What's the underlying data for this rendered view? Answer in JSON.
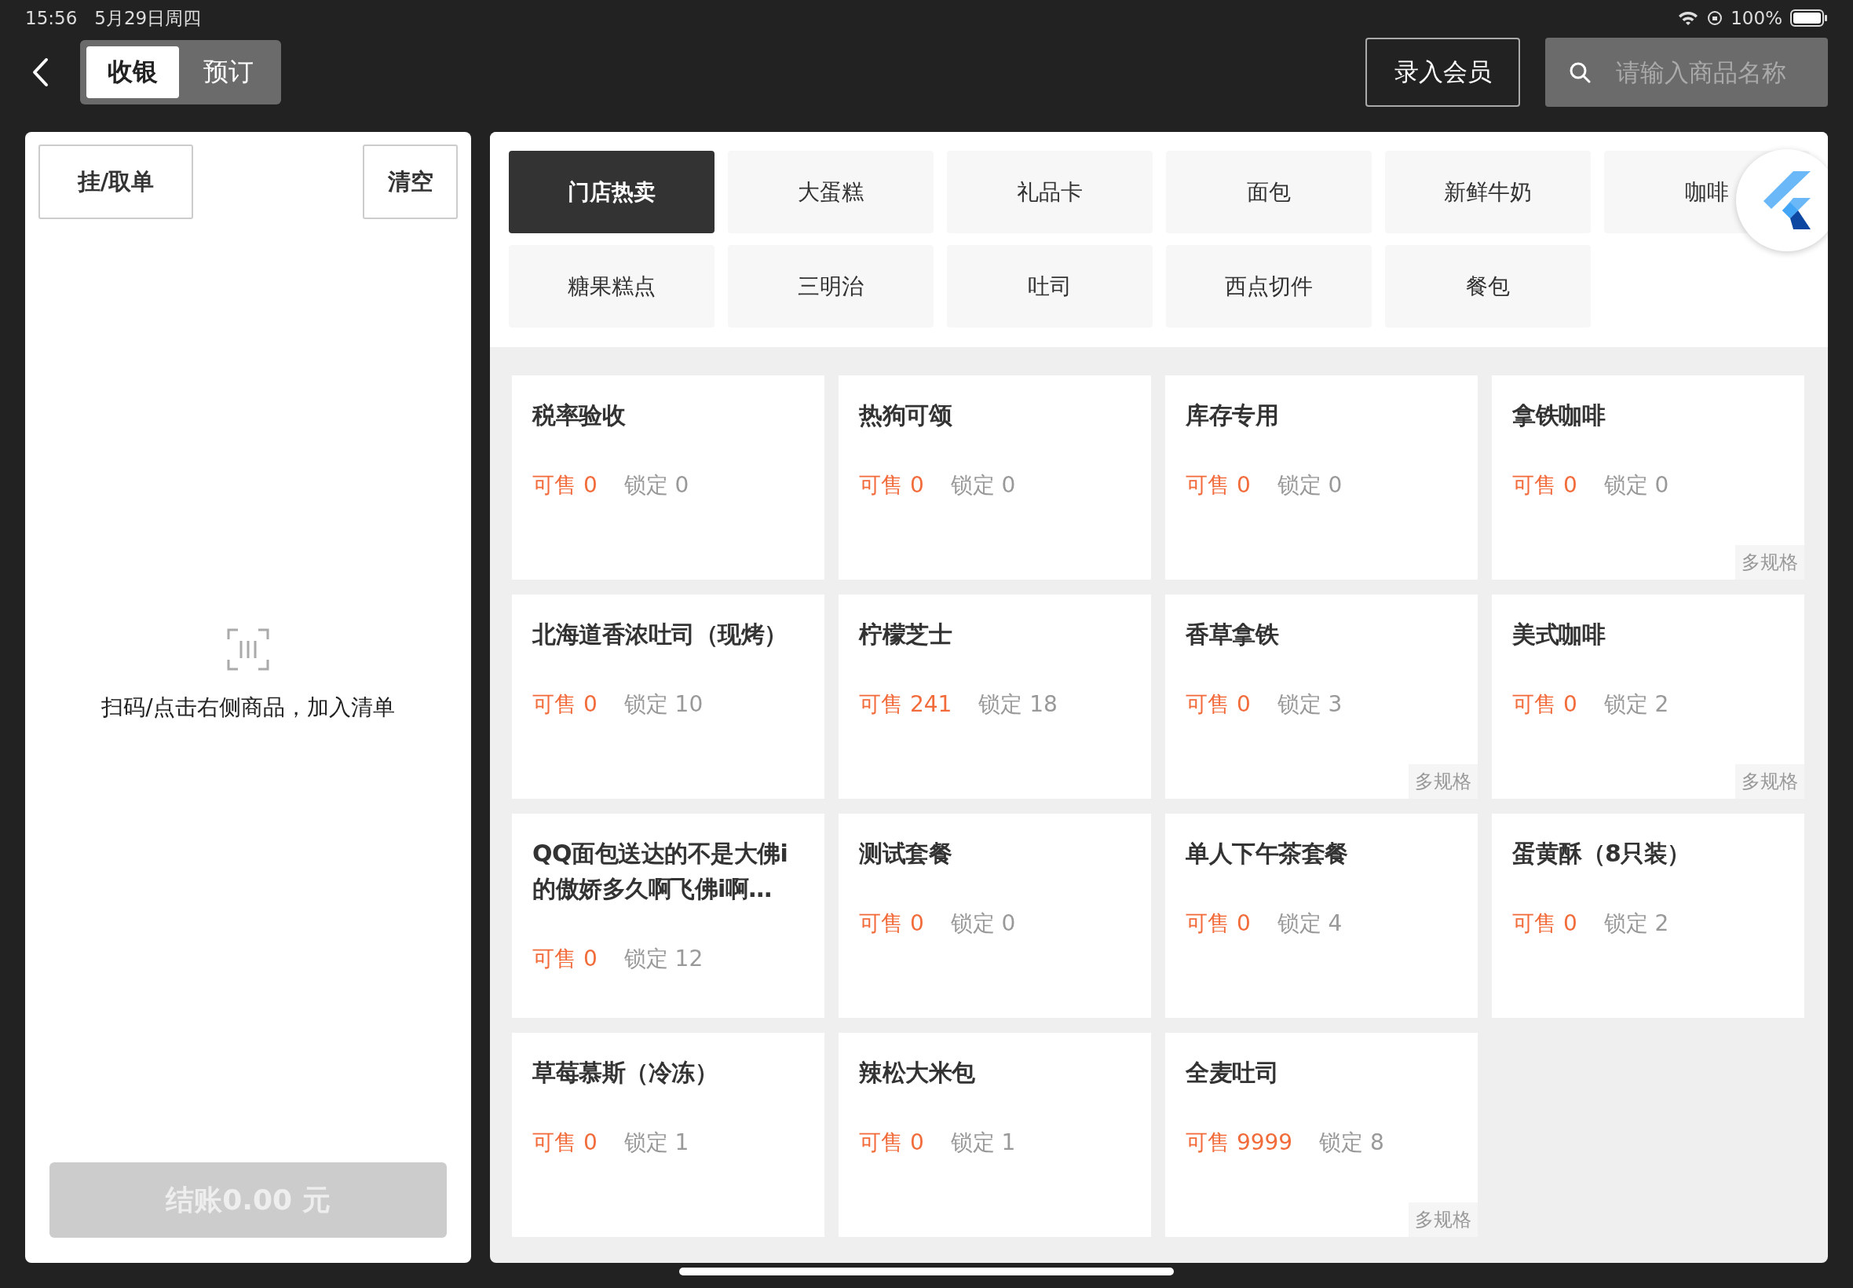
{
  "status_bar": {
    "time": "15:56",
    "date": "5月29日周四",
    "battery": "100%"
  },
  "header": {
    "modes": [
      {
        "label": "收银",
        "selected": true
      },
      {
        "label": "预订",
        "selected": false
      }
    ],
    "member_button": "录入会员",
    "search": {
      "placeholder": "请输入商品名称"
    }
  },
  "cart": {
    "buttons": [
      "挂/取单",
      "清空"
    ],
    "empty_hint": "扫码/点击右侧商品，加入清单",
    "checkout": {
      "label": "结账0.00 元",
      "disabled": true
    }
  },
  "categories": [
    {
      "label": "门店热卖",
      "selected": true
    },
    {
      "label": "大蛋糕",
      "selected": false
    },
    {
      "label": "礼品卡",
      "selected": false
    },
    {
      "label": "面包",
      "selected": false
    },
    {
      "label": "新鲜牛奶",
      "selected": false
    },
    {
      "label": "咖啡",
      "selected": false
    },
    {
      "label": "糖果糕点",
      "selected": false
    },
    {
      "label": "三明治",
      "selected": false
    },
    {
      "label": "吐司",
      "selected": false
    },
    {
      "label": "西点切件",
      "selected": false
    },
    {
      "label": "餐包",
      "selected": false
    }
  ],
  "products": [
    {
      "name": "税率验收",
      "available": "可售 0",
      "locked": "锁定 0"
    },
    {
      "name": "热狗可颂",
      "available": "可售 0",
      "locked": "锁定 0"
    },
    {
      "name": "库存专用",
      "available": "可售 0",
      "locked": "锁定 0"
    },
    {
      "name": "拿铁咖啡",
      "available": "可售 0",
      "locked": "锁定 0",
      "tag": "多规格"
    },
    {
      "name": "北海道香浓吐司（现烤）",
      "available": "可售 0",
      "locked": "锁定 10"
    },
    {
      "name": "柠檬芝士",
      "available": "可售 241",
      "locked": "锁定 18"
    },
    {
      "name": "香草拿铁",
      "available": "可售 0",
      "locked": "锁定 3",
      "tag": "多规格"
    },
    {
      "name": "美式咖啡",
      "available": "可售 0",
      "locked": "锁定 2",
      "tag": "多规格"
    },
    {
      "name": "QQ面包送达的不是大佛i的傲娇多久啊飞佛i啊…",
      "available": "可售 0",
      "locked": "锁定 12"
    },
    {
      "name": "测试套餐",
      "available": "可售 0",
      "locked": "锁定 0"
    },
    {
      "name": "单人下午茶套餐",
      "available": "可售 0",
      "locked": "锁定 4"
    },
    {
      "name": "蛋黄酥（8只装）",
      "available": "可售 0",
      "locked": "锁定 2"
    },
    {
      "name": "草莓慕斯（冷冻）",
      "available": "可售 0",
      "locked": "锁定 1"
    },
    {
      "name": "辣松大米包",
      "available": "可售 0",
      "locked": "锁定 1"
    },
    {
      "name": "全麦吐司",
      "available": "可售 9999",
      "locked": "锁定 8",
      "tag": "多规格"
    }
  ]
}
